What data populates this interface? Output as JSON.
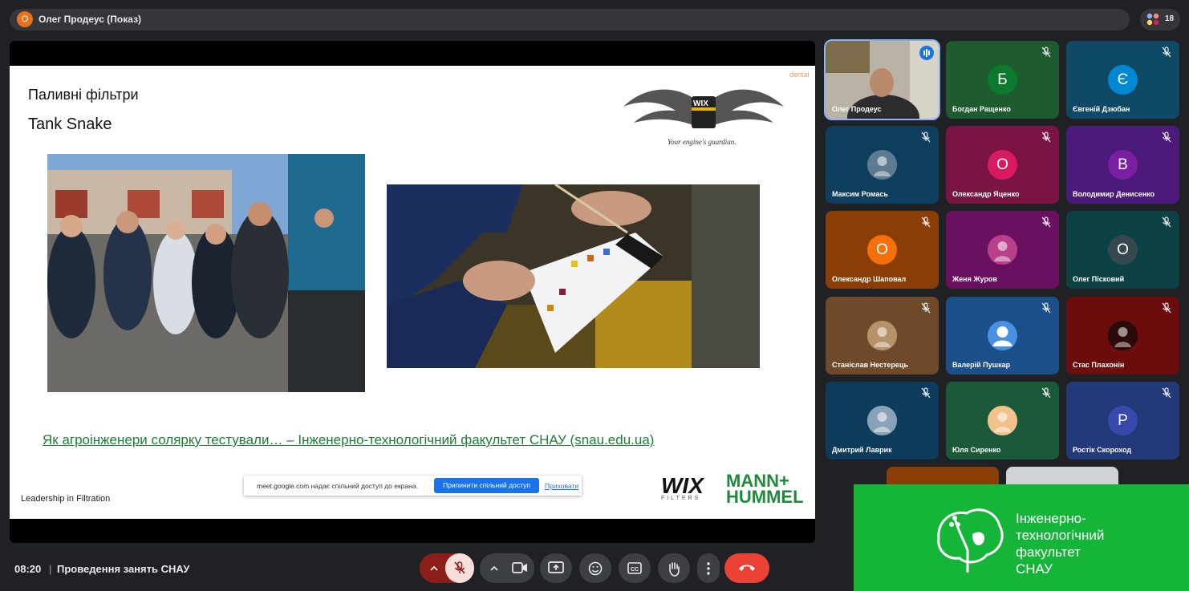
{
  "top": {
    "presenter_initial": "О",
    "presenter_label": "Олег Продеус (Показ)",
    "participant_count": "18"
  },
  "slide": {
    "title1": "Паливні фільтри",
    "title2": "Tank Snake",
    "corner": "dental",
    "wix_tagline": "Your engine's guardian.",
    "link": "Як агроінженери солярку тестували… – Інженерно-технологічний факультет СНАУ (snau.edu.ua)",
    "leadership": "Leadership in Filtration",
    "wix_logo": "WIX",
    "wix_filters": "FILTERS",
    "mann_line1": "MANN+",
    "mann_line2": "HUMMEL"
  },
  "share_bar": {
    "text": "meet.google.com надає спільний доступ до екрана.",
    "stop_label": "Припинити спільний доступ",
    "hide_label": "Приховати"
  },
  "tiles": [
    {
      "name": "Олег Продеус",
      "initial": "",
      "bg": "#4a5a6a",
      "kind": "video",
      "active": true
    },
    {
      "name": "Богдан Ращенко",
      "initial": "Б",
      "bg": "#1e5b2e",
      "av": "#0b7a2f"
    },
    {
      "name": "Євгеній Дзюбан",
      "initial": "Є",
      "bg": "#0e4a66",
      "av": "#0288d1"
    },
    {
      "name": "Максим Ромась",
      "initial": "",
      "bg": "#0d3e5e",
      "av": "#5d7a90",
      "kind": "photo"
    },
    {
      "name": "Олександр Яценко",
      "initial": "О",
      "bg": "#7a1442",
      "av": "#d81b60"
    },
    {
      "name": "Володимир Денисенко",
      "initial": "В",
      "bg": "#4b1a7a",
      "av": "#7b1fa2"
    },
    {
      "name": "Олександр Шаповал",
      "initial": "О",
      "bg": "#8a3e06",
      "av": "#f4700b"
    },
    {
      "name": "Женя Журов",
      "initial": "",
      "bg": "#6a1060",
      "av": "#b8408a",
      "kind": "photo"
    },
    {
      "name": "Олег Пісковий",
      "initial": "О",
      "bg": "#0c4244",
      "av": "#37474f"
    },
    {
      "name": "Станіслав Нестерець",
      "initial": "",
      "bg": "#6e4a2a",
      "av": "#b5926a",
      "kind": "photo"
    },
    {
      "name": "Валерій Пушкар",
      "initial": "",
      "bg": "#1b4f8a",
      "av": "#4a90e2",
      "kind": "person"
    },
    {
      "name": "Стас Плахонін",
      "initial": "",
      "bg": "#6b0d0d",
      "av": "#2b0a0a",
      "kind": "photo"
    },
    {
      "name": "Дмитрий Лаврик",
      "initial": "",
      "bg": "#0d3b5c",
      "av": "#8aa2b8",
      "kind": "photo"
    },
    {
      "name": "Юля Сиренко",
      "initial": "",
      "bg": "#1a5a3a",
      "av": "#f2c28a",
      "kind": "photo"
    },
    {
      "name": "Ростік Скороход",
      "initial": "Р",
      "bg": "#233a7a",
      "av": "#3949ab"
    }
  ],
  "bottom": {
    "time": "08:20",
    "separator": "|",
    "meeting": "Проведення занять СНАУ"
  },
  "green_panel": {
    "line1": "Інженерно-",
    "line2": "технологічний",
    "line3": "факультет",
    "line4": "СНАУ"
  },
  "colors": {
    "accent_green": "#15b53a",
    "hangup": "#ea4335",
    "mic_off": "#f28b82"
  }
}
